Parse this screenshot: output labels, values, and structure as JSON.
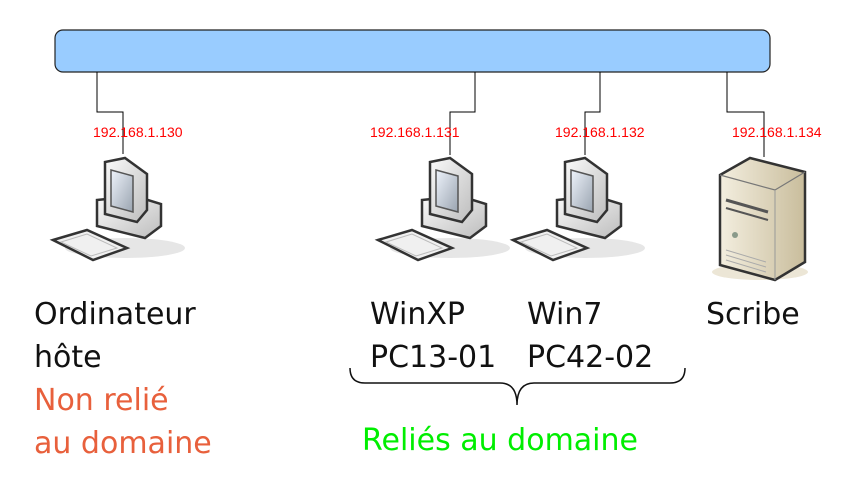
{
  "colors": {
    "bus": "#99ccff",
    "ip": "#ff0000",
    "not_joined": "#e8603c",
    "joined": "#00ee00"
  },
  "nodes": [
    {
      "ip": "192.168.1.130",
      "name_line1": "Ordinateur",
      "name_line2": "hôte",
      "note_line1": "Non relié",
      "note_line2": "au domaine",
      "icon": "desktop-computer-icon"
    },
    {
      "ip": "192.168.1.131",
      "name_line1": "WinXP",
      "name_line2": "PC13-01",
      "icon": "desktop-computer-icon"
    },
    {
      "ip": "192.168.1.132",
      "name_line1": "Win7",
      "name_line2": "PC42-02",
      "icon": "desktop-computer-icon"
    },
    {
      "ip": "192.168.1.134",
      "name_line1": "Scribe",
      "icon": "server-tower-icon"
    }
  ],
  "group_label": "Reliés au domaine"
}
